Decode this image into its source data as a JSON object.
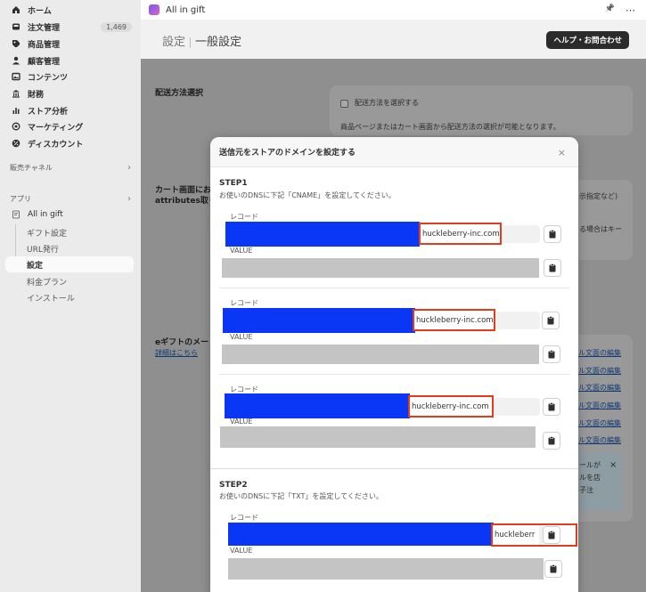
{
  "sidebar": {
    "items": [
      {
        "label": "ホーム",
        "icon": "home-icon"
      },
      {
        "label": "注文管理",
        "icon": "inbox-icon",
        "badge": "1,469"
      },
      {
        "label": "商品管理",
        "icon": "tag-icon"
      },
      {
        "label": "顧客管理",
        "icon": "person-icon"
      },
      {
        "label": "コンテンツ",
        "icon": "content-icon"
      },
      {
        "label": "財務",
        "icon": "bank-icon"
      },
      {
        "label": "ストア分析",
        "icon": "bar-chart-icon"
      },
      {
        "label": "マーケティング",
        "icon": "target-icon"
      },
      {
        "label": "ディスカウント",
        "icon": "discount-icon"
      }
    ],
    "sales_channels": "販売チャネル",
    "apps": "アプリ",
    "app_name": "All in gift",
    "app_sub": [
      "ギフト設定",
      "URL発行",
      "設定",
      "料金プラン",
      "インストール"
    ]
  },
  "topbar": {
    "app_title": "All in gift",
    "pin": "📌",
    "more": "⋯"
  },
  "header": {
    "crumb": "設定",
    "title": "一般設定",
    "help": "ヘルプ・お問合わせ"
  },
  "background": {
    "section1_label": "配送方法選択",
    "checkbox_label": "配送方法を選択する",
    "desc1": "商品ページまたはカート画面から配送方法の選択が可能となります。",
    "section2_label_1": "カート画面にお",
    "section2_label_2": "attributes取り",
    "side_text_1": "示指定など)",
    "side_text_2": "る場合はキー",
    "section3_label": "eギフトのメー",
    "section3_link": "詳細はこちら",
    "edit_links": [
      "ル文面の編集",
      "ル文面の編集",
      "ル文面の編集",
      "ル文面の編集",
      "ル文面の編集",
      "ル文面の編集"
    ],
    "banner_lines": [
      "ールが",
      "ルを店",
      "子注"
    ],
    "banner_close": "×"
  },
  "modal": {
    "title": "送信元をストアのドメインを設定する",
    "close": "×",
    "step1_title": "STEP1",
    "step1_desc": "お使いのDNSに下記「CNAME」を設定してください。",
    "record_label": "レコード",
    "value_label": "VALUE",
    "domain": "huckleberry-inc.com",
    "step2_title": "STEP2",
    "step2_desc": "お使いのDNSに下記「TXT」を設定してください。",
    "domain_truncated": "huckleberr"
  },
  "colors": {
    "redaction_blue": "#0a36f6",
    "highlight_red": "#e53b1d",
    "dark_button": "#2b2b2b"
  }
}
